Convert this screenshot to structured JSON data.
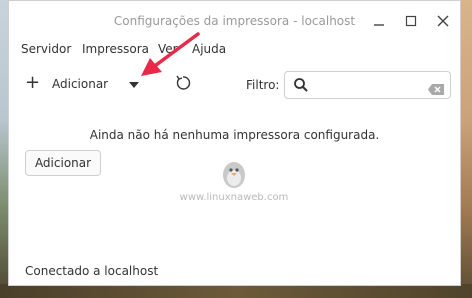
{
  "window": {
    "title": "Configurações da impressora - localhost",
    "minimize_icon": "minimize-icon",
    "maximize_icon": "maximize-icon",
    "close_icon": "close-icon"
  },
  "menubar": {
    "items": [
      "Servidor",
      "Impressora",
      "Ver",
      "Ajuda"
    ]
  },
  "toolbar": {
    "add_label": "Adicionar",
    "add_icon": "plus-icon",
    "dropdown_icon": "caret-down-icon",
    "refresh_icon": "refresh-icon",
    "filter_label": "Filtro:",
    "filter_value": ""
  },
  "main": {
    "empty_message": "Ainda não há nenhuma impressora configurada.",
    "add_button_label": "Adicionar"
  },
  "watermark": {
    "text": "www.linuxnaweb.com"
  },
  "status": {
    "text": "Conectado a localhost"
  },
  "annotation": {
    "arrow_color": "#e8294a"
  }
}
